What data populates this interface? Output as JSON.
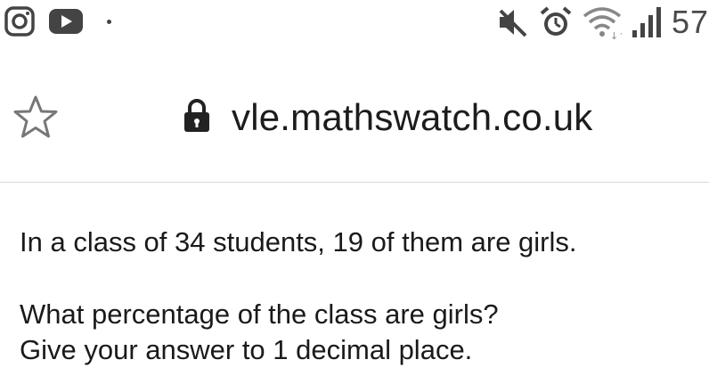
{
  "status_bar": {
    "left_icons": [
      "instagram-icon",
      "youtube-icon",
      "notification-dot"
    ],
    "right_icons": [
      "mute-icon",
      "alarm-icon",
      "wifi-icon",
      "signal-icon"
    ],
    "battery_text": "57"
  },
  "browser": {
    "url": "vle.mathswatch.co.uk",
    "secure_icon": "lock-icon",
    "bookmark_icon": "star-outline-icon"
  },
  "question": {
    "line1": "In a class of 34 students, 19 of them are girls.",
    "line2": "What percentage of the class are girls?",
    "line3": "Give your answer to 1 decimal place."
  }
}
